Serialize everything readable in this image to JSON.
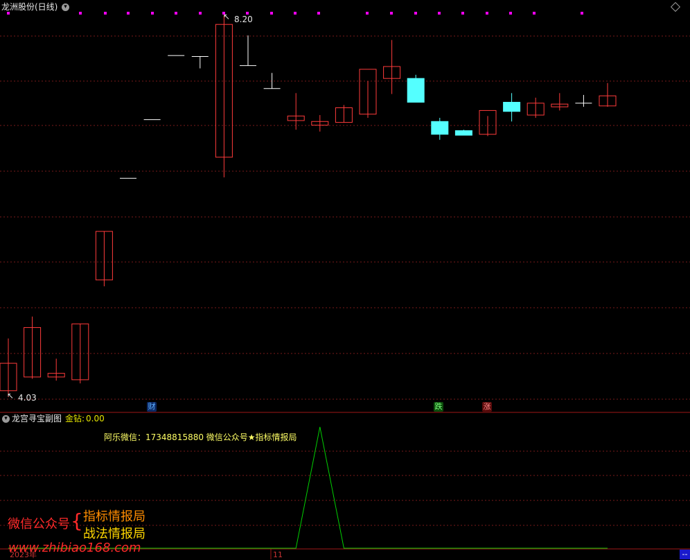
{
  "main_panel": {
    "title": "龙洲股份(日线)",
    "high_label": "8.20",
    "low_label": "4.03",
    "events": [
      {
        "label": "财",
        "color": "#3aa0ff"
      },
      {
        "label": "跌",
        "color": "#19c219"
      },
      {
        "label": "涨",
        "color": "#e03b3b"
      }
    ]
  },
  "sub_panel": {
    "title": "龙宫寻宝副图",
    "indicator_label": "金钻:",
    "indicator_value": "0.00",
    "notice": "阿乐微信：17348815880 微信公众号★指标情报局"
  },
  "date_axis": {
    "year_label": "2023年",
    "month_label": "11",
    "right_label": "--"
  },
  "watermark": {
    "left_text": "微信公众号",
    "line1": "指标情报局",
    "line2": "战法情报局",
    "url": "www.zhibiao168.com"
  },
  "colors": {
    "up": "#ff3b3b",
    "down": "#54ffff",
    "flat": "#ffffff",
    "grid": "#7a1a1a",
    "marker": "#ff00ff",
    "indicator_line": "#00d000"
  },
  "chart_data": {
    "type": "candlestick",
    "price_range": [
      4.03,
      8.2
    ],
    "candles": [
      {
        "open": 4.1,
        "high": 4.67,
        "low": 4.03,
        "close": 4.4,
        "dir": "up"
      },
      {
        "open": 4.25,
        "high": 4.91,
        "low": 4.23,
        "close": 4.79,
        "dir": "up"
      },
      {
        "open": 4.25,
        "high": 4.45,
        "low": 4.21,
        "close": 4.29,
        "dir": "up"
      },
      {
        "open": 4.22,
        "high": 4.83,
        "low": 4.18,
        "close": 4.83,
        "dir": "up"
      },
      {
        "open": 5.31,
        "high": 5.84,
        "low": 5.24,
        "close": 5.84,
        "dir": "up"
      },
      {
        "open": 6.42,
        "high": 6.42,
        "low": 6.42,
        "close": 6.42,
        "dir": "flat"
      },
      {
        "open": 7.06,
        "high": 7.06,
        "low": 7.06,
        "close": 7.06,
        "dir": "flat"
      },
      {
        "open": 7.76,
        "high": 7.76,
        "low": 7.76,
        "close": 7.76,
        "dir": "flat"
      },
      {
        "open": 7.75,
        "high": 7.75,
        "low": 7.62,
        "close": 7.75,
        "dir": "flat"
      },
      {
        "open": 6.65,
        "high": 8.2,
        "low": 6.43,
        "close": 8.1,
        "dir": "up"
      },
      {
        "open": 7.65,
        "high": 7.98,
        "low": 7.65,
        "close": 7.65,
        "dir": "flat"
      },
      {
        "open": 7.4,
        "high": 7.57,
        "low": 7.4,
        "close": 7.4,
        "dir": "flat"
      },
      {
        "open": 7.05,
        "high": 7.35,
        "low": 6.95,
        "close": 7.1,
        "dir": "up"
      },
      {
        "open": 7.0,
        "high": 7.11,
        "low": 6.93,
        "close": 7.04,
        "dir": "up"
      },
      {
        "open": 7.03,
        "high": 7.22,
        "low": 7.03,
        "close": 7.19,
        "dir": "up"
      },
      {
        "open": 7.12,
        "high": 7.48,
        "low": 7.08,
        "close": 7.61,
        "dir": "up"
      },
      {
        "open": 7.51,
        "high": 7.93,
        "low": 7.34,
        "close": 7.64,
        "dir": "up"
      },
      {
        "open": 7.51,
        "high": 7.55,
        "low": 7.25,
        "close": 7.25,
        "dir": "down"
      },
      {
        "open": 7.04,
        "high": 7.08,
        "low": 6.84,
        "close": 6.9,
        "dir": "down"
      },
      {
        "open": 6.94,
        "high": 6.95,
        "low": 6.89,
        "close": 6.89,
        "dir": "down"
      },
      {
        "open": 6.9,
        "high": 7.1,
        "low": 6.88,
        "close": 7.16,
        "dir": "up"
      },
      {
        "open": 7.25,
        "high": 7.35,
        "low": 7.04,
        "close": 7.15,
        "dir": "down"
      },
      {
        "open": 7.11,
        "high": 7.3,
        "low": 7.08,
        "close": 7.24,
        "dir": "up"
      },
      {
        "open": 7.23,
        "high": 7.35,
        "low": 7.16,
        "close": 7.2,
        "dir": "up"
      },
      {
        "open": 7.24,
        "high": 7.33,
        "low": 7.2,
        "close": 7.24,
        "dir": "flat"
      },
      {
        "open": 7.21,
        "high": 7.46,
        "low": 7.2,
        "close": 7.32,
        "dir": "up"
      }
    ],
    "indicator_series": [
      0,
      0,
      0,
      0,
      0,
      0,
      0,
      0,
      0,
      0,
      0,
      0,
      0,
      1,
      0,
      0,
      0,
      0,
      0,
      0,
      0,
      0,
      0,
      0,
      0,
      0
    ]
  }
}
